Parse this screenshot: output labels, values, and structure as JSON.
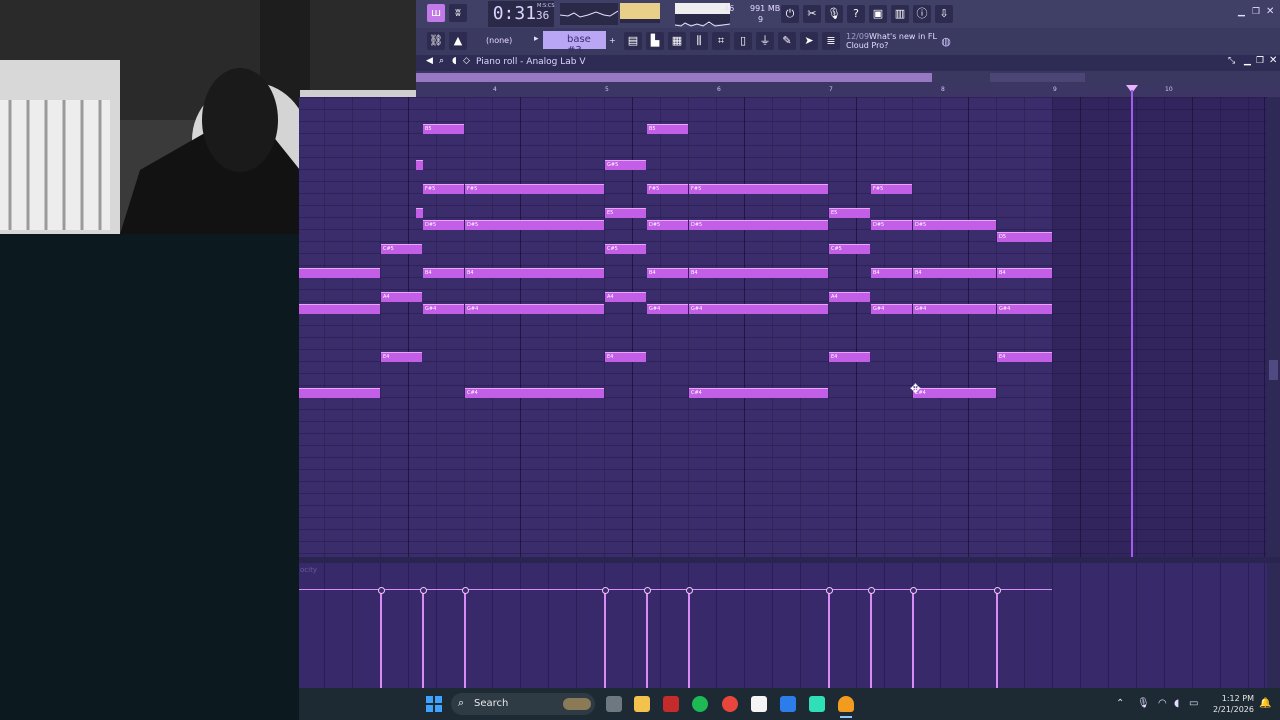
{
  "app": {
    "time_main": "0:31",
    "time_sub": "36",
    "time_unit": "M:S:CS",
    "cpu_value": "46",
    "memory": "991 MB",
    "voices": "9",
    "pattern_none": "(none)",
    "pattern_name": "base #3",
    "news_date": "12/09",
    "news_text_1": "What's new in FL",
    "news_text_2": "Cloud Pro?"
  },
  "piano_roll": {
    "title": "Piano roll - Analog Lab V",
    "ruler_ticks": [
      "4",
      "5",
      "6",
      "7",
      "8",
      "9",
      "10"
    ],
    "velocity_label": "ocity",
    "notes": [
      {
        "label": "F#5",
        "row": 1
      },
      {
        "label": "D#5",
        "row": 2
      },
      {
        "label": "C#5",
        "row": 3
      },
      {
        "label": "B4",
        "row": 4
      },
      {
        "label": "A#4",
        "row": 5
      },
      {
        "label": "G#4",
        "row": 6
      },
      {
        "label": "F#4",
        "row": 7
      },
      {
        "label": "E4",
        "row": 8
      },
      {
        "label": "D#4",
        "row": 9
      },
      {
        "label": "C#4",
        "row": 10
      }
    ]
  },
  "taskbar": {
    "search_placeholder": "Search",
    "time": "1:12 PM",
    "date": "2/21/2026"
  },
  "colors": {
    "note": "#c25fe6",
    "grid": "#3b2d6b",
    "playhead": "#a45bf0",
    "velocity": "#d98cf6"
  }
}
